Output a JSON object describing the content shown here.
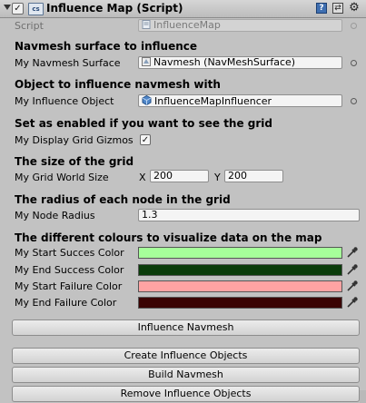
{
  "header": {
    "title": "Influence Map (Script)",
    "enabled_glyph": "✓",
    "script_badge": "cs",
    "help_glyph": "?",
    "preset_glyph": "⇄",
    "gear_glyph": "⚙"
  },
  "script": {
    "label": "Script",
    "value": "InfluenceMap"
  },
  "navmesh_surface": {
    "header": "Navmesh surface to influence",
    "label": "My Navmesh Surface",
    "value": "Navmesh (NavMeshSurface)"
  },
  "influence_object": {
    "header": "Object to influence navmesh with",
    "label": "My Influence Object",
    "value": "InfluenceMapInfluencer"
  },
  "display_grid": {
    "header": "Set as enabled if you want to see the grid",
    "label": "My Display Grid Gizmos",
    "checked": true,
    "check_glyph": "✓"
  },
  "grid_size": {
    "header": "The size of the grid",
    "label": "My Grid World Size",
    "x_label": "X",
    "x_value": "200",
    "y_label": "Y",
    "y_value": "200"
  },
  "node_radius": {
    "header": "The radius of each node in the grid",
    "label": "My Node Radius",
    "value": "1.3"
  },
  "colors": {
    "header": "The different colours to visualize data on the map",
    "items": [
      {
        "label": "My Start Succes Color",
        "hex": "#a6ff9a"
      },
      {
        "label": "My End Success Color",
        "hex": "#0b3c0b"
      },
      {
        "label": "My Start Failure Color",
        "hex": "#ffa3a3"
      },
      {
        "label": "My End Failure Color",
        "hex": "#3a0303"
      }
    ]
  },
  "buttons": {
    "influence_navmesh": "Influence Navmesh",
    "create_objects": "Create Influence Objects",
    "build_navmesh": "Build Navmesh",
    "remove_objects": "Remove Influence Objects"
  }
}
